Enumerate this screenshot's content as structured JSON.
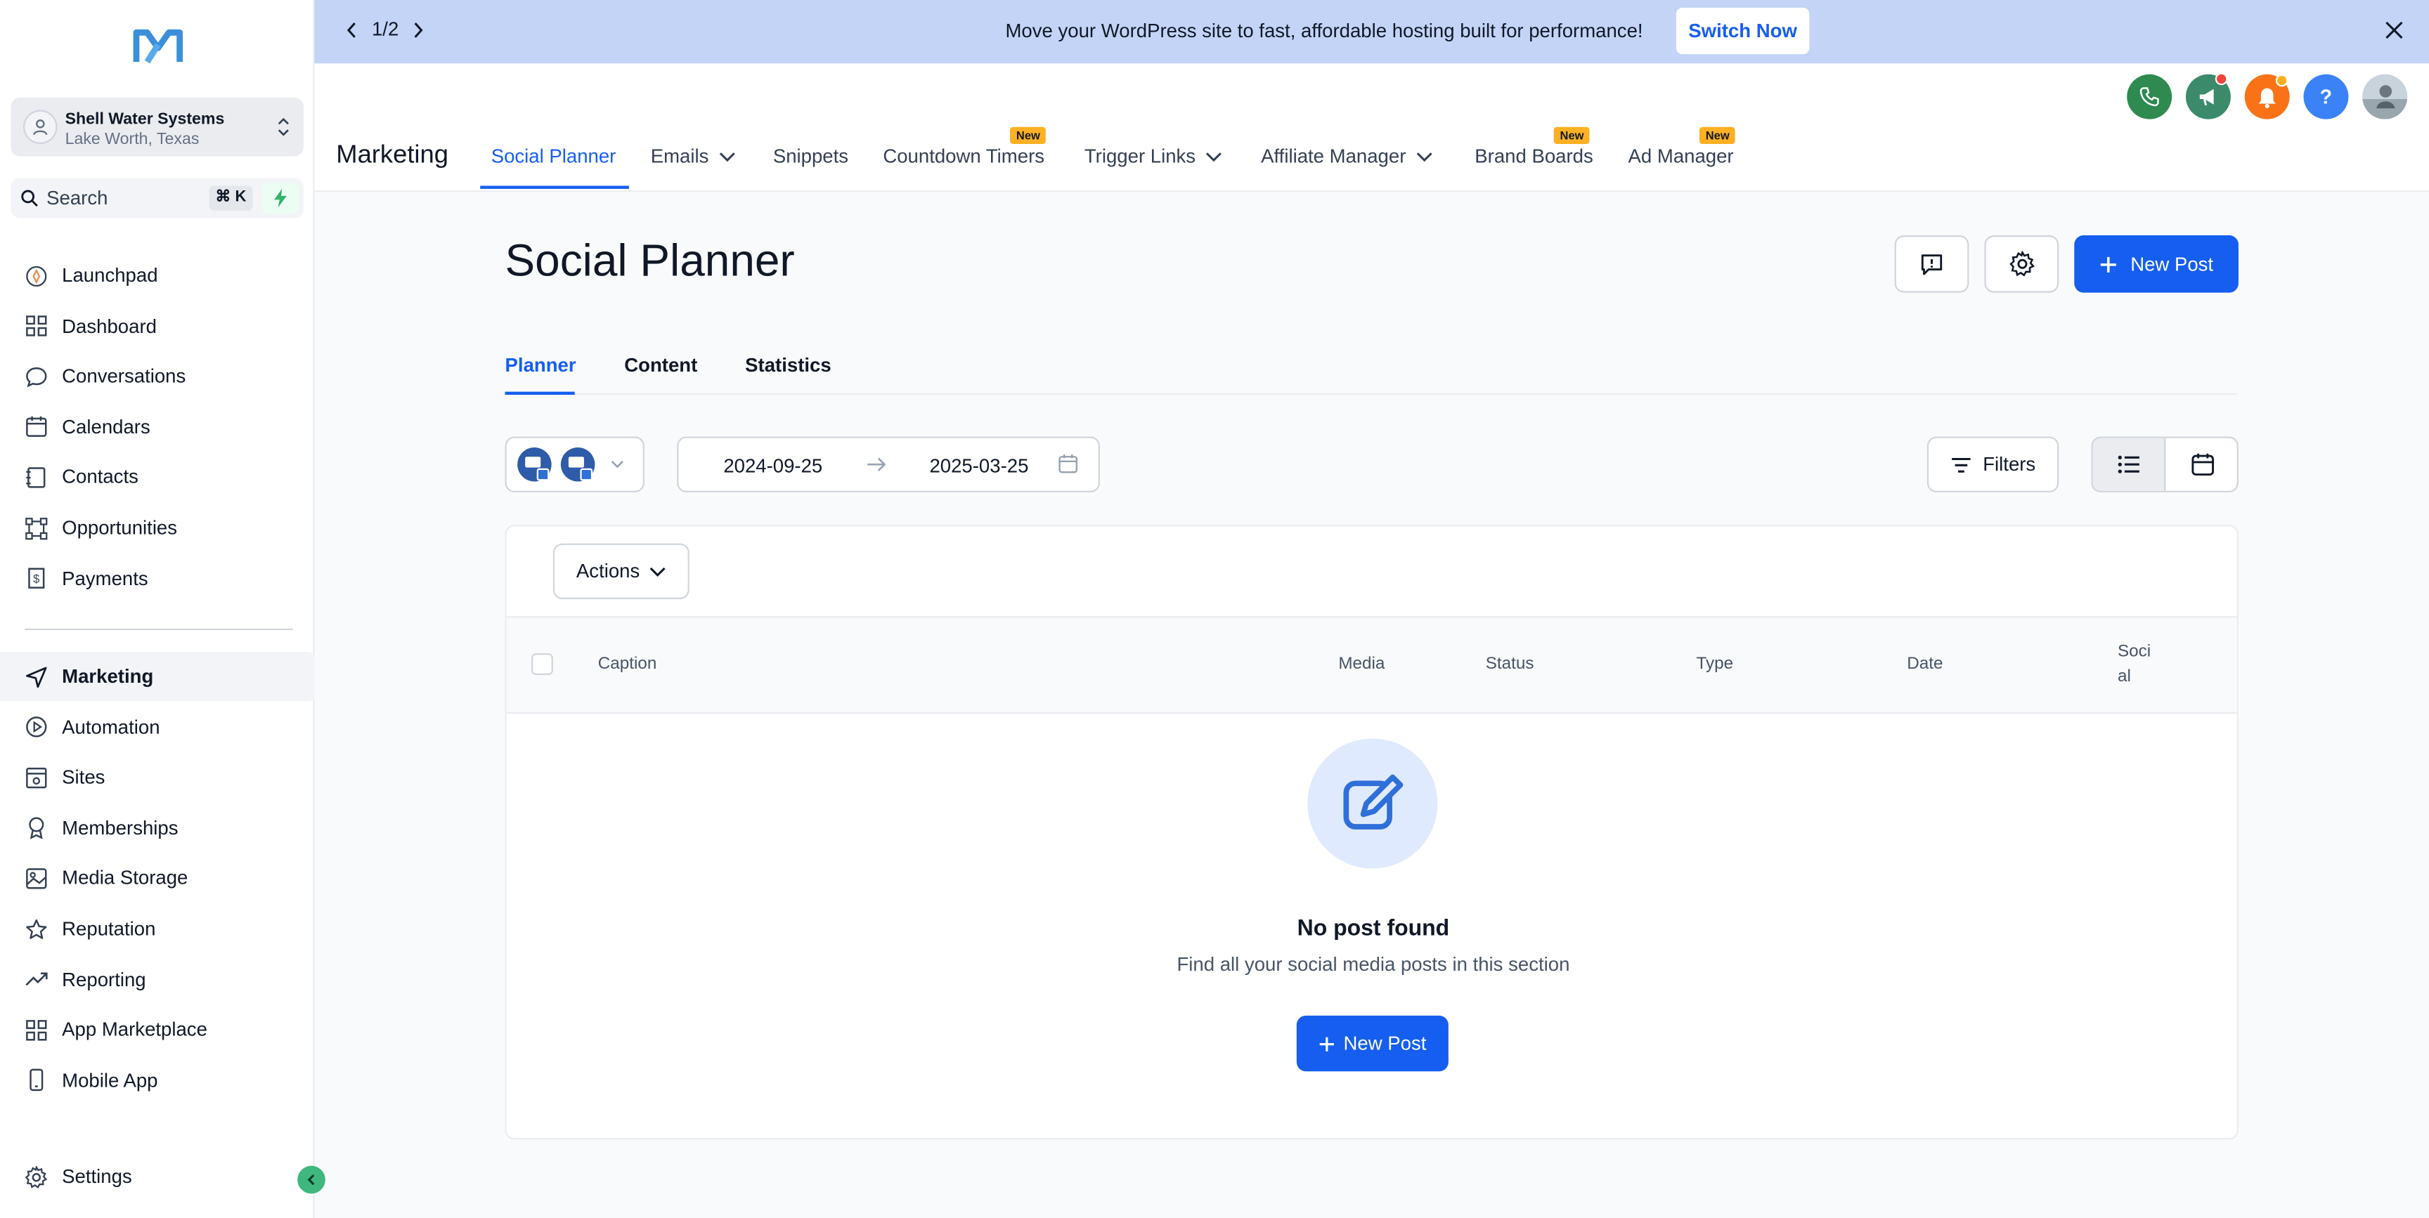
{
  "sidebar": {
    "account": {
      "name": "Shell Water Systems",
      "location": "Lake Worth, Texas"
    },
    "search": {
      "label": "Search",
      "shortcut": "⌘ K"
    },
    "items": [
      {
        "label": "Launchpad",
        "icon": "rocket-icon"
      },
      {
        "label": "Dashboard",
        "icon": "grid-icon"
      },
      {
        "label": "Conversations",
        "icon": "chat-icon"
      },
      {
        "label": "Calendars",
        "icon": "calendar-icon"
      },
      {
        "label": "Contacts",
        "icon": "contact-book-icon"
      },
      {
        "label": "Opportunities",
        "icon": "funnel-icon"
      },
      {
        "label": "Payments",
        "icon": "receipt-icon"
      }
    ],
    "items2": [
      {
        "label": "Marketing",
        "icon": "send-icon",
        "active": true
      },
      {
        "label": "Automation",
        "icon": "play-icon"
      },
      {
        "label": "Sites",
        "icon": "browser-icon"
      },
      {
        "label": "Memberships",
        "icon": "badge-icon"
      },
      {
        "label": "Media Storage",
        "icon": "image-icon"
      },
      {
        "label": "Reputation",
        "icon": "star-icon"
      },
      {
        "label": "Reporting",
        "icon": "trend-icon"
      },
      {
        "label": "App Marketplace",
        "icon": "apps-icon"
      },
      {
        "label": "Mobile App",
        "icon": "phone-icon"
      }
    ],
    "settings_label": "Settings"
  },
  "banner": {
    "pager": "1/2",
    "message": "Move your WordPress site to fast, affordable hosting built for performance!",
    "cta": "Switch Now"
  },
  "header": {
    "title": "Marketing",
    "tabs": [
      {
        "label": "Social Planner",
        "active": true
      },
      {
        "label": "Emails",
        "dropdown": true
      },
      {
        "label": "Snippets"
      },
      {
        "label": "Countdown Timers",
        "badge": "New"
      },
      {
        "label": "Trigger Links",
        "dropdown": true
      },
      {
        "label": "Affiliate Manager",
        "dropdown": true
      },
      {
        "label": "Brand Boards",
        "badge": "New"
      },
      {
        "label": "Ad Manager",
        "badge": "New"
      }
    ],
    "icons": [
      {
        "name": "phone-icon",
        "color": "#2e8a4f"
      },
      {
        "name": "megaphone-icon",
        "color": "#3b8a6b"
      },
      {
        "name": "bell-icon",
        "color": "#f97316"
      },
      {
        "name": "help-icon",
        "color": "#3b82f6"
      }
    ]
  },
  "main": {
    "title": "Social Planner",
    "new_post": "New Post",
    "subtabs": [
      {
        "label": "Planner",
        "active": true
      },
      {
        "label": "Content"
      },
      {
        "label": "Statistics"
      }
    ],
    "date_from": "2024-09-25",
    "date_to": "2025-03-25",
    "filters": "Filters",
    "actions": "Actions",
    "columns": [
      "Caption",
      "Media",
      "Status",
      "Type",
      "Date",
      "Social"
    ],
    "empty_title": "No post found",
    "empty_sub": "Find all your social media posts in this section",
    "empty_cta": "New Post"
  },
  "colors": {
    "primary": "#155eef",
    "banner_bg": "#c3d4f6",
    "new_badge": "#fdb022"
  }
}
